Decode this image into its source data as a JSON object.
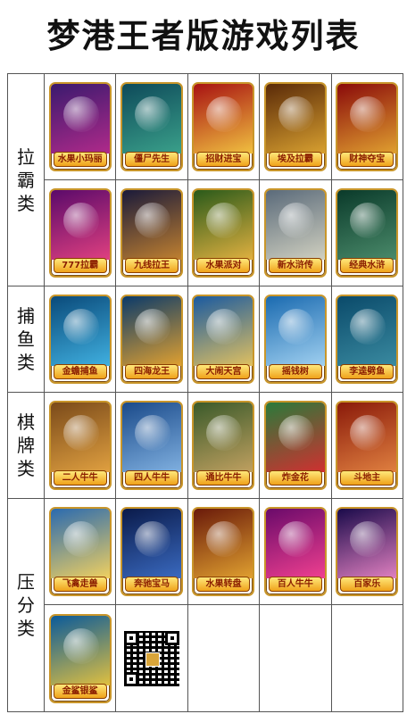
{
  "title": "梦港王者版游戏列表",
  "categories": [
    {
      "chars": [
        "拉",
        "霸",
        "类"
      ]
    },
    {
      "chars": [
        "捕",
        "鱼",
        "类"
      ]
    },
    {
      "chars": [
        "棋",
        "牌",
        "类"
      ]
    },
    {
      "chars": [
        "压",
        "分",
        "类"
      ]
    }
  ],
  "games": [
    {
      "label": "水果小玛丽",
      "colors": [
        "#3a1a6e",
        "#b02a8a"
      ]
    },
    {
      "label": "僵尸先生",
      "colors": [
        "#0e4a5a",
        "#3aa08a"
      ]
    },
    {
      "label": "招财进宝",
      "colors": [
        "#a81212",
        "#f0c040"
      ]
    },
    {
      "label": "埃及拉霸",
      "colors": [
        "#5a2a08",
        "#d8a030"
      ]
    },
    {
      "label": "财神夺宝",
      "colors": [
        "#8a0a0a",
        "#e0a030"
      ]
    },
    {
      "label": "777拉霸",
      "colors": [
        "#5a0a6a",
        "#e04080"
      ]
    },
    {
      "label": "九线拉王",
      "colors": [
        "#1a1a3a",
        "#c08030"
      ]
    },
    {
      "label": "水果派对",
      "colors": [
        "#2a5a1a",
        "#e0b040"
      ]
    },
    {
      "label": "新水浒传",
      "colors": [
        "#5a6a7a",
        "#d0d0c0"
      ]
    },
    {
      "label": "经典水浒",
      "colors": [
        "#0a3a2a",
        "#4a8a6a"
      ]
    },
    {
      "label": "金蟾捕鱼",
      "colors": [
        "#0a4a7a",
        "#40b0e0"
      ]
    },
    {
      "label": "四海龙王",
      "colors": [
        "#0a3a6a",
        "#e0a030"
      ]
    },
    {
      "label": "大闹天宫",
      "colors": [
        "#1a5aa0",
        "#e0c060"
      ]
    },
    {
      "label": "摇钱树",
      "colors": [
        "#1a6ab0",
        "#a0d0f0"
      ]
    },
    {
      "label": "李逵劈鱼",
      "colors": [
        "#0a4a6a",
        "#3a8aa0"
      ]
    },
    {
      "label": "二人牛牛",
      "colors": [
        "#7a4a1a",
        "#e0a040"
      ]
    },
    {
      "label": "四人牛牛",
      "colors": [
        "#1a4a8a",
        "#80b0e0"
      ]
    },
    {
      "label": "通比牛牛",
      "colors": [
        "#3a5a2a",
        "#c0a060"
      ]
    },
    {
      "label": "炸金花",
      "colors": [
        "#2a7a3a",
        "#d03030"
      ]
    },
    {
      "label": "斗地主",
      "colors": [
        "#8a1a0a",
        "#e08040"
      ]
    },
    {
      "label": "飞禽走兽",
      "colors": [
        "#2a6ab0",
        "#f0d060"
      ]
    },
    {
      "label": "奔驰宝马",
      "colors": [
        "#0a1a4a",
        "#3a6ac0"
      ]
    },
    {
      "label": "水果转盘",
      "colors": [
        "#6a1a0a",
        "#e0a030"
      ]
    },
    {
      "label": "百人牛牛",
      "colors": [
        "#6a0a6a",
        "#f04090"
      ]
    },
    {
      "label": "百家乐",
      "colors": [
        "#1a0a4a",
        "#e080c0"
      ]
    },
    {
      "label": "金鲨银鲨",
      "colors": [
        "#0a5a9a",
        "#e0c040"
      ]
    }
  ]
}
